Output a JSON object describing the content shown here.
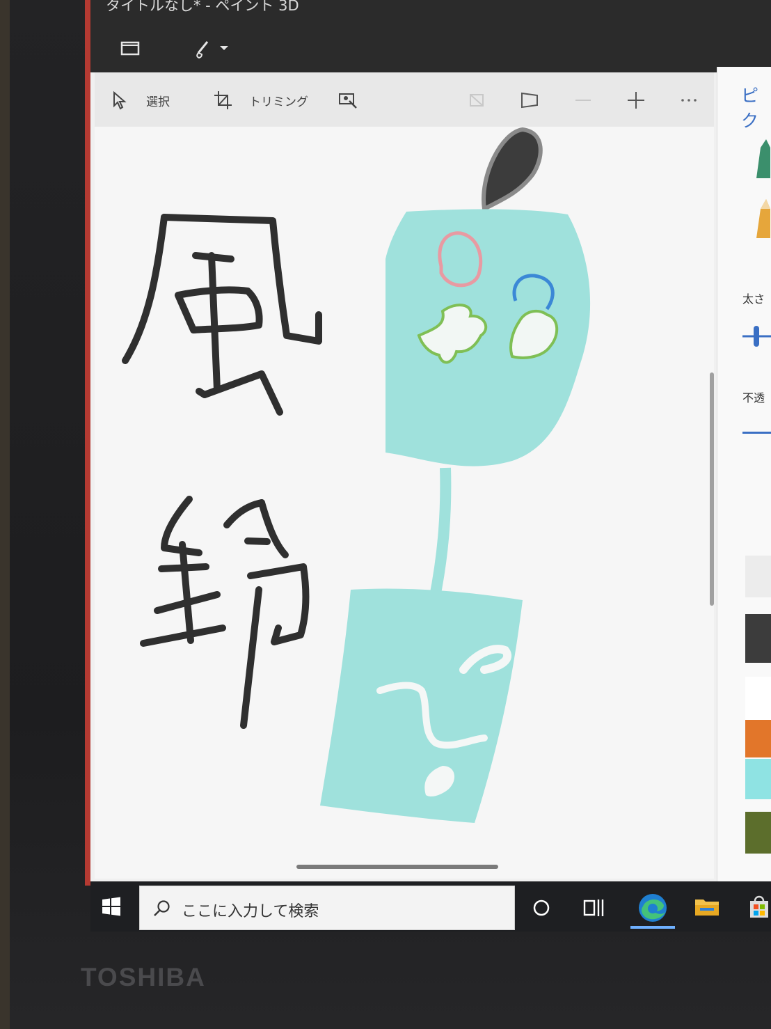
{
  "window": {
    "title": "タイトルなし* - ペイント 3D"
  },
  "menubar": {
    "file_icon": "folder-icon",
    "brush_icon": "brush-icon"
  },
  "toolbar": {
    "select_label": "選択",
    "crop_label": "トリミング",
    "magic_select_icon": "magic-select-icon",
    "icons": [
      "3d-view-icon",
      "canvas-icon",
      "zoom-out-icon",
      "zoom-in-icon",
      "more-icon"
    ]
  },
  "sidepanel": {
    "title": "ピク",
    "thickness_label": "太さ",
    "opacity_label": "不透",
    "swatches": [
      "#3c3c3c",
      "#ffffff",
      "#e2762a",
      "#8fe3e3",
      "#5c6e2c"
    ]
  },
  "canvas": {
    "drawing": {
      "kanji_1": "風",
      "kanji_2": "鈴",
      "subject": "wind chime"
    }
  },
  "taskbar": {
    "search_placeholder": "ここに入力して検索",
    "icons": [
      "start-icon",
      "search-icon",
      "cortana-icon",
      "task-view-icon",
      "edge-icon",
      "file-explorer-icon",
      "store-icon"
    ]
  },
  "device": {
    "brand": "TOSHIBA"
  }
}
